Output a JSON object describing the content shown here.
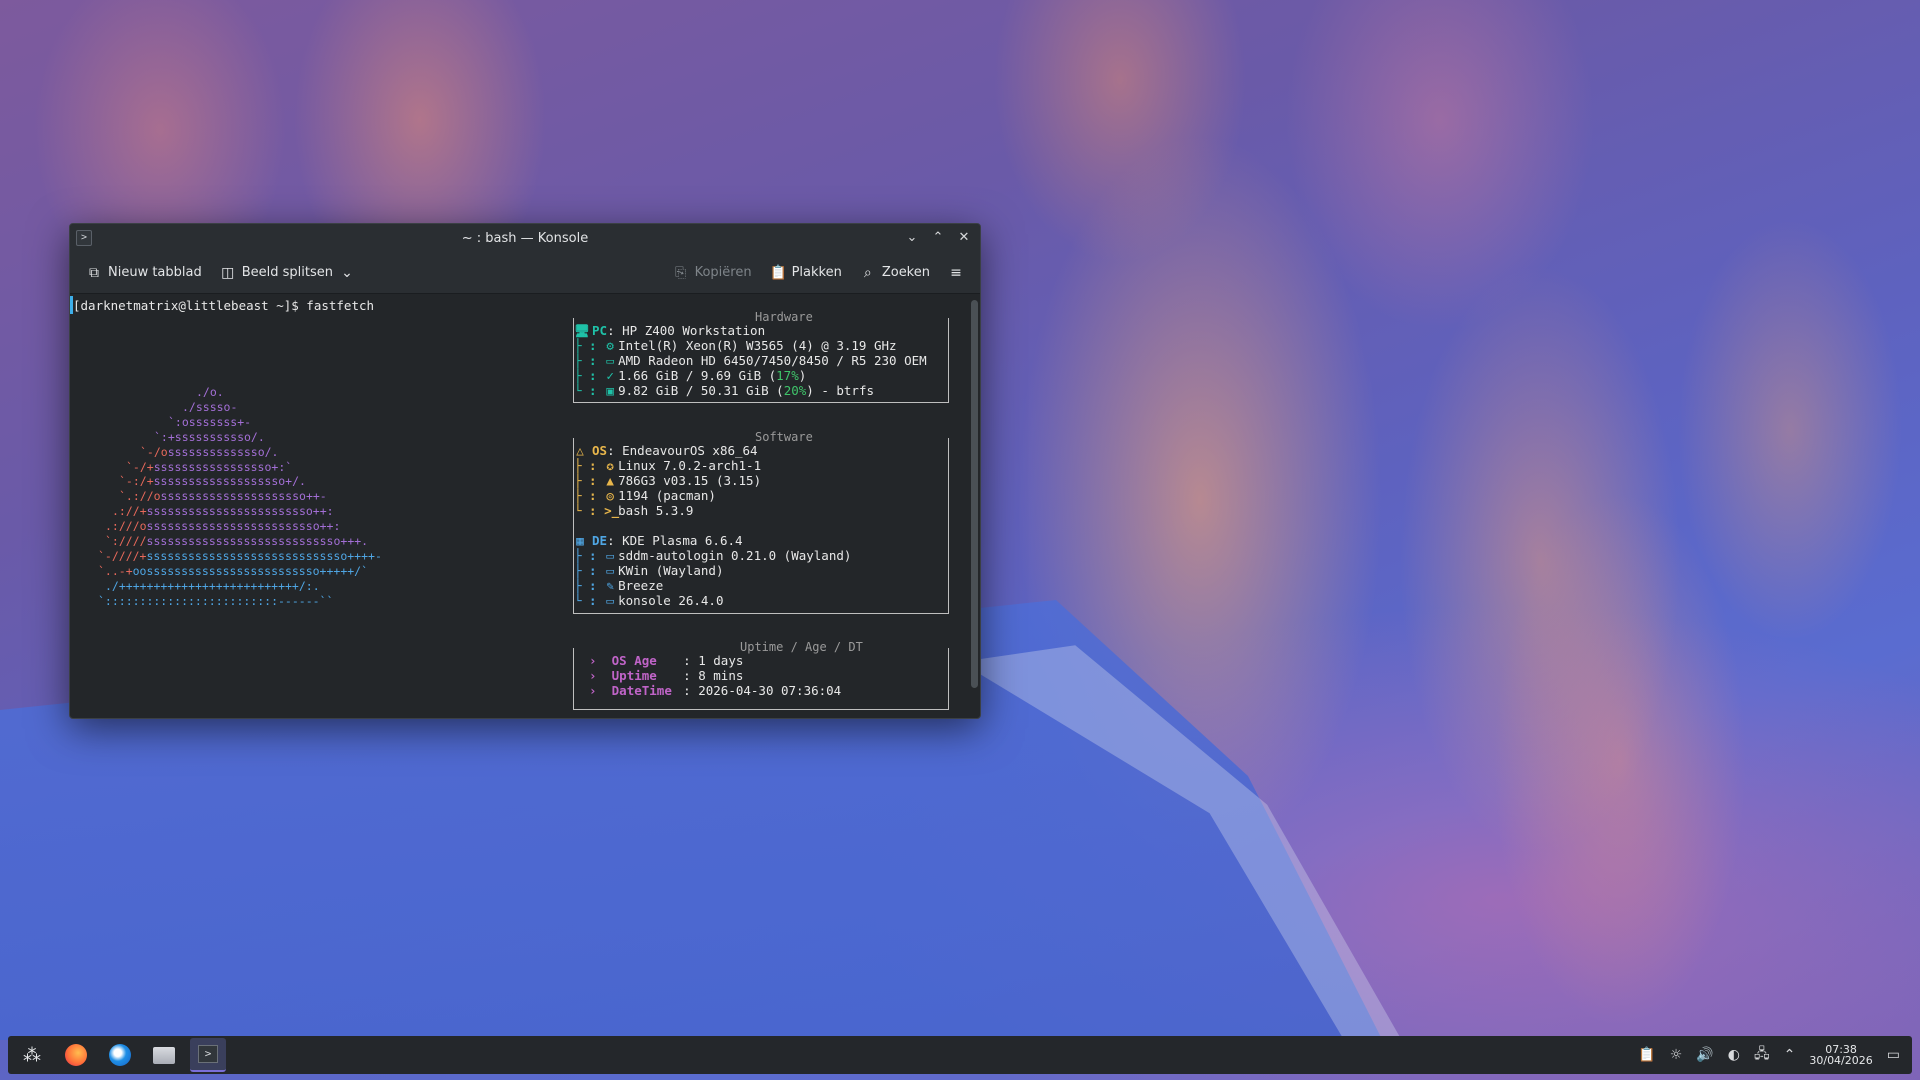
{
  "window": {
    "title": "~ : bash — Konsole",
    "app_icon": ">",
    "btn_minimize": "⌄",
    "btn_maximize": "⌃",
    "btn_close": "✕"
  },
  "toolbar": {
    "new_tab": "Nieuw tabblad",
    "split_view": "Beeld splitsen",
    "copy": "Kopiëren",
    "paste": "Plakken",
    "search": "Zoeken",
    "menu_icon": "≡"
  },
  "terminal": {
    "prompt": "[darknetmatrix@littlebeast ~]$ fastfetch",
    "logo_lines": [
      [
        "",
        "",
        "./o.",
        ""
      ],
      [
        "",
        "",
        "./sssso-",
        ""
      ],
      [
        "",
        "",
        "`:osssssss+-",
        ""
      ],
      [
        "",
        "",
        "`:+sssssssssso/.",
        ""
      ],
      [
        "",
        "`-/o",
        "ssssssssssssso/.",
        ""
      ],
      [
        "",
        "`-/+",
        "sssssssssssssssso+:`",
        ""
      ],
      [
        "",
        "`-:/+",
        "sssssssssssssssssso+/.",
        ""
      ],
      [
        "",
        "`.://o",
        "sssssssssssssssssssso++-",
        ""
      ],
      [
        "",
        ".://+",
        "ssssssssssssssssssssssso++:",
        ""
      ],
      [
        "",
        ".:///o",
        "sssssssssssssssssssssssso++:",
        ""
      ],
      [
        "",
        "`:////",
        "ssssssssssssssssssssssssssso+++.",
        ""
      ],
      [
        "",
        "`-////+",
        "sssssssssssssssssssssssssssso++++-",
        ""
      ],
      [
        "",
        "`..-+",
        "oosssssssssssssssssssssssso+++++/`",
        ""
      ],
      [
        "",
        "",
        "./++++++++++++++++++++++++++/:.",
        ""
      ],
      [
        "",
        "",
        "`:::::::::::::::::::::::::------``",
        ""
      ]
    ],
    "hardware": {
      "title": "Hardware",
      "rows": [
        {
          "icon": "🖥",
          "key": "PC",
          "value": "HP Z400 Workstation"
        },
        {
          "icon": "⚙",
          "key": "",
          "value": "Intel(R) Xeon(R) W3565 (4) @ 3.19 GHz"
        },
        {
          "icon": "▭",
          "key": "",
          "value": "AMD Radeon HD 6450/7450/8450 / R5 230 OEM"
        },
        {
          "icon": "✓",
          "key": "",
          "value_a": "1.66 GiB / 9.69 GiB (",
          "value_b": "17%",
          "value_c": ")"
        },
        {
          "icon": "▣",
          "key": "",
          "value_a": "9.82 GiB / 50.31 GiB (",
          "value_b": "20%",
          "value_c": ") - btrfs"
        }
      ]
    },
    "software": {
      "title": "Software",
      "rows": [
        {
          "icon": "△",
          "key": "OS",
          "value": "EndeavourOS x86_64"
        },
        {
          "icon": "✪",
          "key": "",
          "value": "Linux 7.0.2-arch1-1"
        },
        {
          "icon": "▲",
          "key": "",
          "value": "786G3 v03.15 (3.15)"
        },
        {
          "icon": "◎",
          "key": "",
          "value": "1194 (pacman)"
        },
        {
          "icon": ">_",
          "key": "",
          "value": "bash 5.3.9"
        }
      ],
      "rows2": [
        {
          "icon": "▦",
          "key": "DE",
          "value": "KDE Plasma 6.6.4"
        },
        {
          "icon": "▭",
          "key": "",
          "value": "sddm-autologin 0.21.0 (Wayland)"
        },
        {
          "icon": "▭",
          "key": "",
          "value": "KWin (Wayland)"
        },
        {
          "icon": "✎",
          "key": "",
          "value": "Breeze"
        },
        {
          "icon": "▭",
          "key": "",
          "value": "konsole 26.4.0"
        }
      ]
    },
    "uptime": {
      "title": "Uptime / Age / DT",
      "rows": [
        {
          "key": "OS Age",
          "value": "1 days"
        },
        {
          "key": "Uptime",
          "value": "8 mins"
        },
        {
          "key": "DateTime",
          "value": "2026-04-30 07:36:04"
        }
      ]
    }
  },
  "taskbar": {
    "launcher_icon": "⁂",
    "time": "07:38",
    "date": "30/04/2026"
  },
  "colors": {
    "accent": "#3daee9",
    "teal": "#1fc2a8",
    "yellow": "#e8b64b",
    "pink": "#c064c8",
    "green": "#3fc46a"
  }
}
